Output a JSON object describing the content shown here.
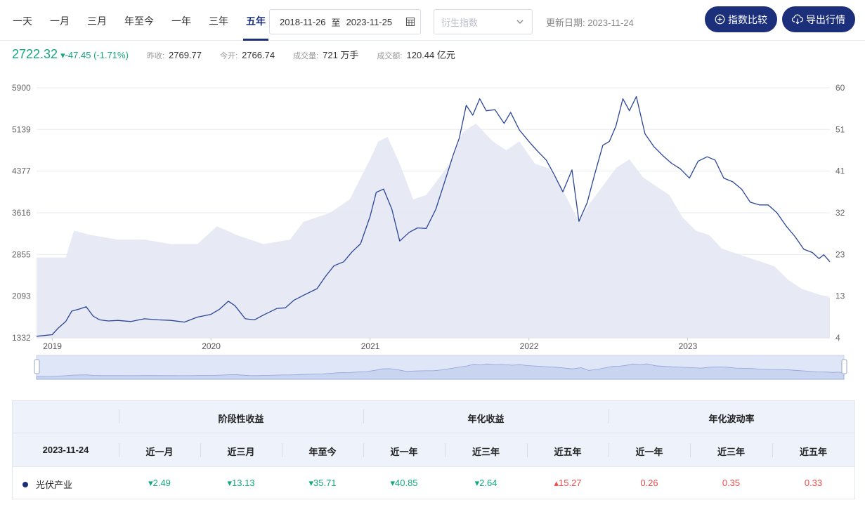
{
  "toolbar": {
    "range_tabs": [
      "一天",
      "一月",
      "三月",
      "年至今",
      "一年",
      "三年",
      "五年"
    ],
    "active_tab": "五年",
    "date_start": "2018-11-26",
    "date_sep": "至",
    "date_end": "2023-11-25",
    "derived_placeholder": "衍生指数",
    "update_label": "更新日期: 2023-11-24",
    "compare_label": "指数比较",
    "export_label": "导出行情"
  },
  "quote": {
    "price": "2722.32",
    "change": "▾-47.45 (-1.71%)",
    "prev_close_label": "昨收:",
    "prev_close": "2769.77",
    "open_label": "今开:",
    "open": "2766.74",
    "volume_label": "成交量:",
    "volume": "721 万手",
    "turnover_label": "成交额:",
    "turnover": "120.44 亿元"
  },
  "colors": {
    "accent": "#1b2f7a",
    "line": "#2a4598",
    "area": "#e4e8f3",
    "down": "#13a87d",
    "up": "#f04b4b"
  },
  "chart_data": {
    "type": "line",
    "x_ticks": [
      "2019",
      "2020",
      "2021",
      "2022",
      "2023"
    ],
    "y_left_ticks": [
      1332,
      2093,
      2855,
      3616,
      4377,
      5139,
      5900
    ],
    "y_left_range": [
      1332,
      5900
    ],
    "y_right_ticks": [
      4,
      13,
      23,
      32,
      41,
      51,
      60
    ],
    "y_right_range": [
      4,
      60
    ],
    "grid": true,
    "series": [
      {
        "axis": "left",
        "style": "line",
        "x": [
          "2018-11-26",
          "2019-01-01",
          "2019-01-15",
          "2019-02-01",
          "2019-02-15",
          "2019-03-05",
          "2019-03-20",
          "2019-04-05",
          "2019-04-20",
          "2019-05-10",
          "2019-06-01",
          "2019-07-01",
          "2019-08-01",
          "2019-09-01",
          "2019-10-01",
          "2019-11-01",
          "2019-12-01",
          "2020-01-01",
          "2020-01-20",
          "2020-02-10",
          "2020-02-25",
          "2020-03-20",
          "2020-04-10",
          "2020-05-01",
          "2020-06-01",
          "2020-06-20",
          "2020-07-10",
          "2020-08-01",
          "2020-09-01",
          "2020-09-20",
          "2020-10-10",
          "2020-11-01",
          "2020-11-20",
          "2020-12-10",
          "2021-01-01",
          "2021-01-15",
          "2021-02-01",
          "2021-02-20",
          "2021-03-10",
          "2021-04-01",
          "2021-04-20",
          "2021-05-10",
          "2021-06-01",
          "2021-06-20",
          "2021-07-10",
          "2021-07-25",
          "2021-08-10",
          "2021-08-25",
          "2021-09-10",
          "2021-09-25",
          "2021-10-15",
          "2021-11-05",
          "2021-11-20",
          "2021-12-10",
          "2022-01-01",
          "2022-01-20",
          "2022-02-10",
          "2022-03-01",
          "2022-03-20",
          "2022-04-10",
          "2022-04-26",
          "2022-05-15",
          "2022-06-01",
          "2022-06-20",
          "2022-07-05",
          "2022-07-20",
          "2022-08-05",
          "2022-08-20",
          "2022-09-05",
          "2022-09-25",
          "2022-10-15",
          "2022-11-05",
          "2022-11-25",
          "2022-12-15",
          "2023-01-05",
          "2023-01-25",
          "2023-02-15",
          "2023-03-05",
          "2023-03-25",
          "2023-04-15",
          "2023-05-05",
          "2023-05-25",
          "2023-06-15",
          "2023-07-05",
          "2023-07-25",
          "2023-08-15",
          "2023-09-05",
          "2023-09-25",
          "2023-10-15",
          "2023-10-30",
          "2023-11-10",
          "2023-11-24"
        ],
        "values": [
          1360,
          1390,
          1510,
          1630,
          1820,
          1860,
          1900,
          1730,
          1660,
          1640,
          1650,
          1630,
          1680,
          1660,
          1650,
          1620,
          1710,
          1760,
          1850,
          2000,
          1920,
          1680,
          1660,
          1750,
          1870,
          1880,
          2020,
          2110,
          2230,
          2450,
          2650,
          2720,
          2900,
          3050,
          3550,
          3990,
          4050,
          3680,
          3100,
          3260,
          3340,
          3330,
          3680,
          4150,
          4650,
          4980,
          5580,
          5400,
          5700,
          5480,
          5500,
          5250,
          5450,
          5130,
          4920,
          4750,
          4580,
          4300,
          4000,
          4400,
          3460,
          3800,
          4310,
          4850,
          4920,
          5200,
          5700,
          5480,
          5740,
          5060,
          4830,
          4660,
          4520,
          4420,
          4250,
          4560,
          4640,
          4580,
          4250,
          4180,
          4050,
          3810,
          3760,
          3760,
          3620,
          3380,
          3180,
          2950,
          2890,
          2780,
          2850,
          2722
        ]
      },
      {
        "axis": "right",
        "style": "area",
        "x": [
          "2018-11-26",
          "2019-02-01",
          "2019-02-20",
          "2019-04-01",
          "2019-06-01",
          "2019-08-01",
          "2019-10-01",
          "2019-12-01",
          "2020-01-15",
          "2020-03-01",
          "2020-05-01",
          "2020-07-01",
          "2020-08-01",
          "2020-10-01",
          "2020-11-15",
          "2021-01-01",
          "2021-01-20",
          "2021-02-10",
          "2021-03-10",
          "2021-04-10",
          "2021-05-10",
          "2021-06-10",
          "2021-07-10",
          "2021-08-01",
          "2021-09-01",
          "2021-10-10",
          "2021-11-10",
          "2021-12-10",
          "2022-01-15",
          "2022-02-15",
          "2022-03-15",
          "2022-04-26",
          "2022-05-20",
          "2022-06-20",
          "2022-07-20",
          "2022-08-20",
          "2022-09-20",
          "2022-10-20",
          "2022-11-20",
          "2022-12-20",
          "2023-01-20",
          "2023-02-20",
          "2023-03-20",
          "2023-04-20",
          "2023-05-20",
          "2023-06-20",
          "2023-07-20",
          "2023-08-20",
          "2023-09-20",
          "2023-10-20",
          "2023-11-24"
        ],
        "values": [
          22,
          22,
          28,
          27,
          26,
          26,
          25,
          25,
          29,
          27,
          25,
          26,
          30,
          32,
          35,
          44,
          48,
          49,
          43,
          35,
          36,
          40,
          44,
          50,
          52,
          48,
          46,
          48,
          43,
          42,
          38,
          30,
          34,
          38,
          42,
          44,
          40,
          38,
          36,
          31,
          28,
          27,
          24,
          23,
          22,
          21,
          20,
          17,
          15,
          14,
          13
        ]
      }
    ]
  },
  "table": {
    "date": "2023-11-24",
    "groups": [
      "阶段性收益",
      "年化收益",
      "年化波动率"
    ],
    "columns": [
      "近一月",
      "近三月",
      "年至今",
      "近一年",
      "近三年",
      "近五年",
      "近一年",
      "近三年",
      "近五年"
    ],
    "row": {
      "name": "光伏产业",
      "values": [
        "▾2.49",
        "▾13.13",
        "▾35.71",
        "▾40.85",
        "▾2.64",
        "▴15.27",
        "0.26",
        "0.35",
        "0.33"
      ],
      "status": [
        "down",
        "down",
        "down",
        "down",
        "down",
        "up",
        "up",
        "up",
        "up"
      ]
    }
  }
}
